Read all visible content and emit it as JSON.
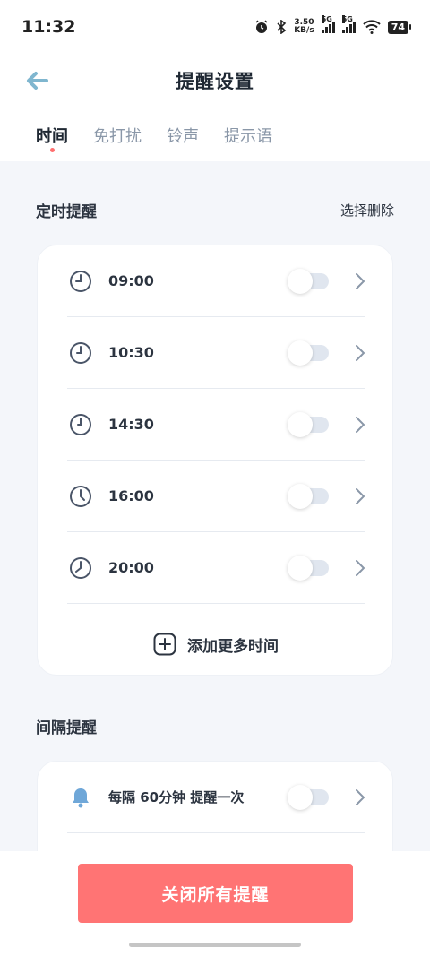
{
  "status": {
    "time": "11:32",
    "net_speed_value": "3.50",
    "net_speed_unit": "KB/s",
    "signal1": "5G",
    "signal2": "5G",
    "battery": "74"
  },
  "header": {
    "title": "提醒设置"
  },
  "tabs": [
    {
      "label": "时间",
      "active": true
    },
    {
      "label": "免打扰",
      "active": false
    },
    {
      "label": "铃声",
      "active": false
    },
    {
      "label": "提示语",
      "active": false
    }
  ],
  "timed": {
    "title": "定时提醒",
    "action": "选择删除",
    "items": [
      {
        "time": "09:00",
        "enabled": false
      },
      {
        "time": "10:30",
        "enabled": false
      },
      {
        "time": "14:30",
        "enabled": false
      },
      {
        "time": "16:00",
        "enabled": false
      },
      {
        "time": "20:00",
        "enabled": false
      }
    ],
    "add_label": "添加更多时间"
  },
  "interval": {
    "title": "间隔提醒",
    "items": [
      {
        "label": "每隔 60分钟 提醒一次",
        "enabled": false
      }
    ]
  },
  "footer": {
    "button": "关闭所有提醒"
  },
  "colors": {
    "accent": "#ff7474",
    "back_arrow": "#7fb6cf",
    "icon": "#4a5568"
  }
}
